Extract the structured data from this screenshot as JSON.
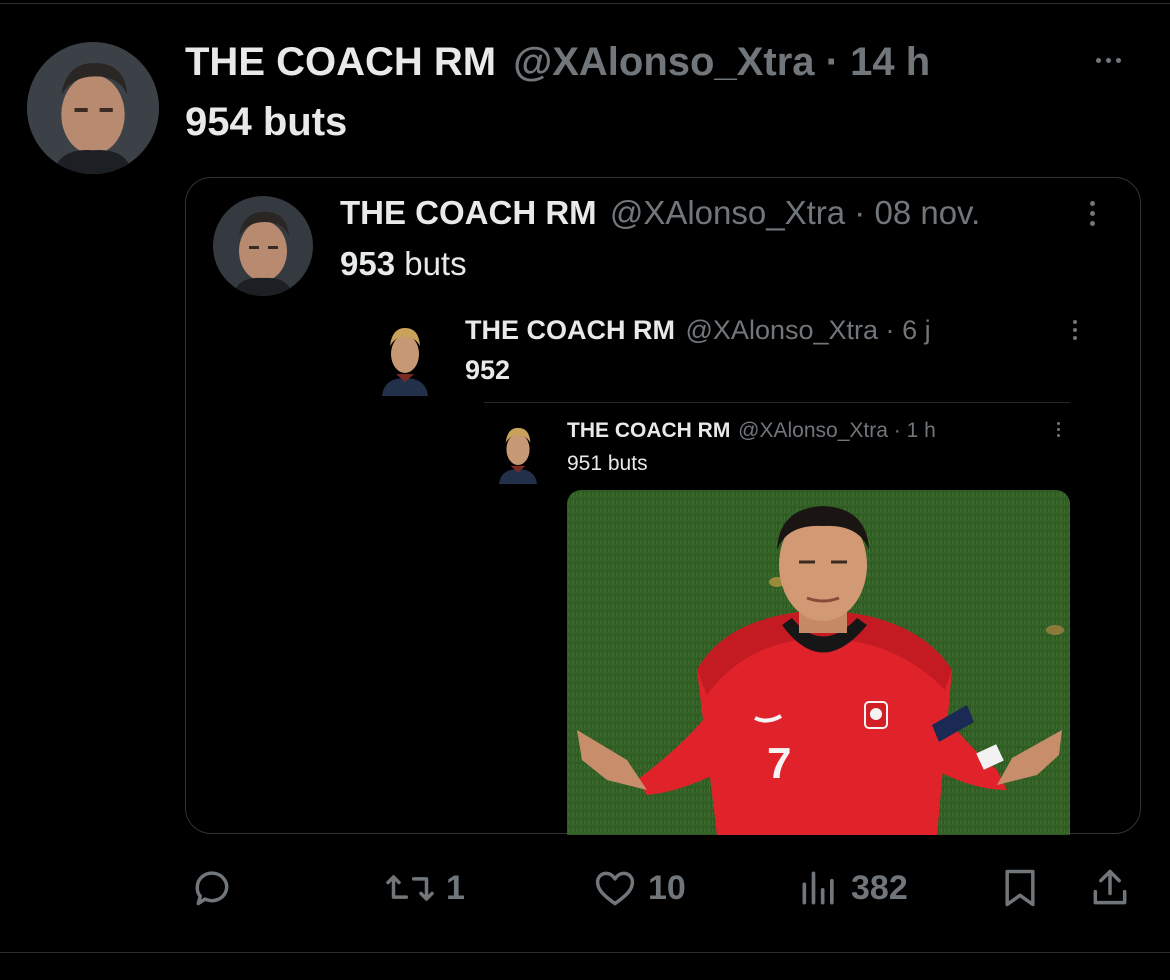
{
  "tweet": {
    "display_name": "THE COACH RM",
    "handle": "@XAlonso_Xtra",
    "separator": "·",
    "time": "14 h",
    "text": "954 buts"
  },
  "quote": {
    "display_name": "THE COACH RM",
    "handle": "@XAlonso_Xtra",
    "separator": "·",
    "time": "08 nov.",
    "text_number": "953",
    "text_word": " buts"
  },
  "nested1": {
    "display_name": "THE COACH RM",
    "handle": "@XAlonso_Xtra",
    "separator": "·",
    "time": "6 j",
    "text": "952"
  },
  "nested2": {
    "display_name": "THE COACH RM",
    "handle": "@XAlonso_Xtra",
    "separator": "·",
    "time": "1 h",
    "text": "951 buts",
    "jersey_number": "7"
  },
  "actions": {
    "reply_count": "",
    "retweet_count": "1",
    "like_count": "10",
    "views_count": "382"
  },
  "colors": {
    "background": "#000000",
    "text_primary": "#e7e9ea",
    "text_muted": "#71767b",
    "border": "#2f3336",
    "jersey_red": "#e0232b",
    "grass": "#2f5a22"
  },
  "icons": [
    "more-icon",
    "reply-icon",
    "retweet-icon",
    "like-icon",
    "views-icon",
    "bookmark-icon",
    "share-icon"
  ]
}
